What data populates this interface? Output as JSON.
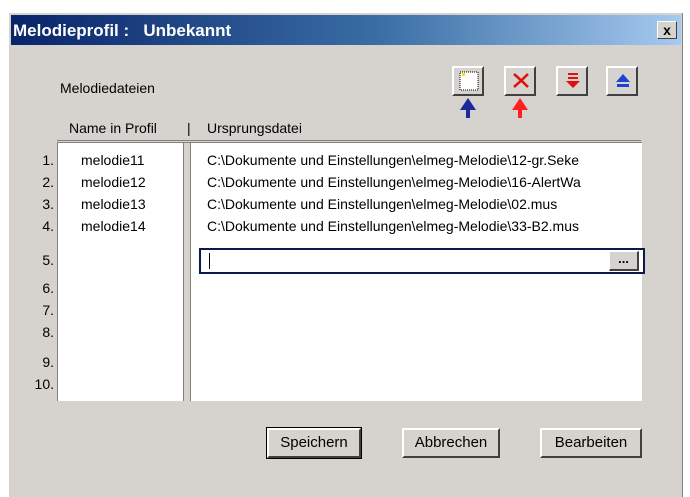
{
  "window": {
    "title": "Melodieprofil :   Unbekannt",
    "close_label": "x"
  },
  "section_label": "Melodiedateien",
  "toolbar": {
    "icons": [
      "new-file-icon",
      "delete-icon",
      "move-down-icon",
      "move-up-icon"
    ],
    "arrow_colors": {
      "blue": "#1a2a9a",
      "red": "#ff2020",
      "green": "#1a8a3a"
    }
  },
  "table": {
    "headers": {
      "name": "Name in Profil",
      "separator": "|",
      "source": "Ursprungsdatei"
    },
    "row_numbers": [
      "1.",
      "2.",
      "3.",
      "4.",
      "5.",
      "6.",
      "7.",
      "8.",
      "9.",
      "10."
    ],
    "rows": [
      {
        "name": "melodie11",
        "source": "C:\\Dokumente und Einstellungen\\elmeg-Melodie\\12-gr.Seke"
      },
      {
        "name": "melodie12",
        "source": "C:\\Dokumente und Einstellungen\\elmeg-Melodie\\16-AlertWa"
      },
      {
        "name": "melodie13",
        "source": "C:\\Dokumente und Einstellungen\\elmeg-Melodie\\02.mus"
      },
      {
        "name": "melodie14",
        "source": "C:\\Dokumente und Einstellungen\\elmeg-Melodie\\33-B2.mus"
      }
    ],
    "edit_row": {
      "value": "",
      "browse_label": "..."
    }
  },
  "buttons": {
    "save": "Speichern",
    "cancel": "Abbrechen",
    "edit": "Bearbeiten"
  }
}
